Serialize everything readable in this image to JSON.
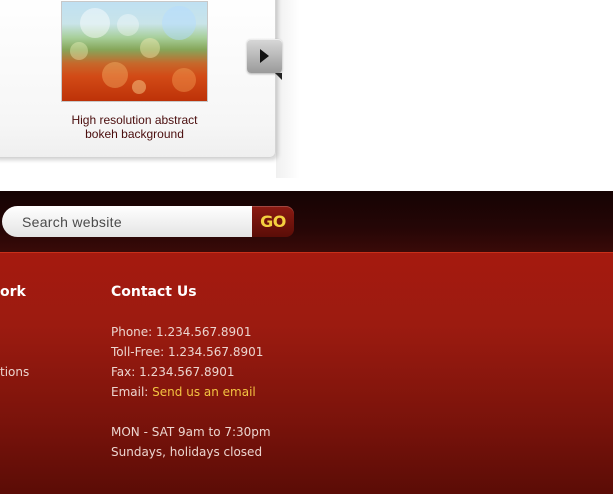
{
  "gallery": {
    "caption_line1": "High resolution abstract",
    "caption_line2": "bokeh background",
    "next_icon": "triangle-right-icon"
  },
  "search": {
    "placeholder": "Search website",
    "go_label": "GO"
  },
  "footer": {
    "left_heading_partial": "ork",
    "left_item_partial": "tions",
    "contact": {
      "heading": "Contact Us",
      "phone": "Phone: 1.234.567.8901",
      "tollfree": "Toll-Free: 1.234.567.8901",
      "fax": "Fax: 1.234.567.8901",
      "email_label": "Email:",
      "email_link": "Send us an email",
      "hours": "MON - SAT 9am to 7:30pm",
      "closed": "Sundays, holidays closed"
    }
  },
  "colors": {
    "footer_red": "#9c1b10",
    "footer_dark": "#150303",
    "go_text": "#f4d03f",
    "link_yellow": "#f3c342"
  }
}
